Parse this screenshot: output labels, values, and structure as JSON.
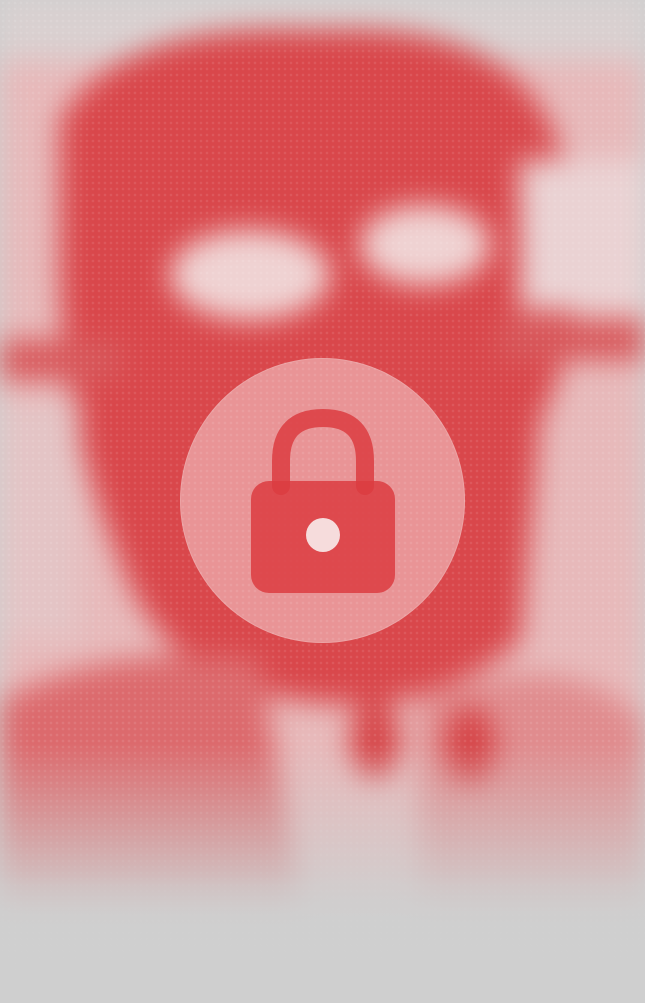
{
  "overlay": {
    "icon": "lock-icon",
    "circle_color": "#ffffff",
    "lock_color": "#dc3c41",
    "art_tint": "#d94a4e",
    "background": "#cfcfcf"
  }
}
